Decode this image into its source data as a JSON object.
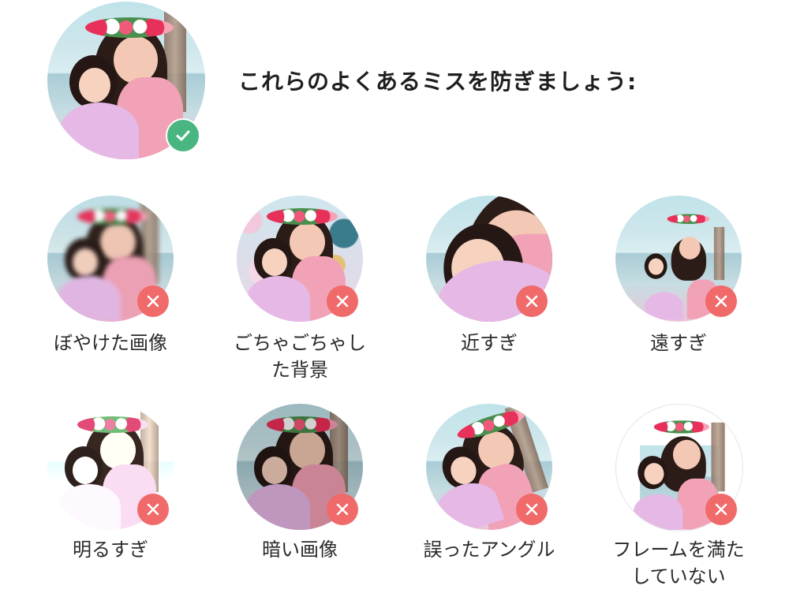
{
  "headline": "これらのよくあるミスを防ぎましょう:",
  "good_example": {
    "status": "correct",
    "badge_icon": "check-icon",
    "badge_color": "#49b581"
  },
  "mistakes": [
    {
      "key": "blurry",
      "label": "ぼやけた画像"
    },
    {
      "key": "cluttered",
      "label_line1": "ごちゃごちゃし",
      "label_line2": "た背景"
    },
    {
      "key": "too-close",
      "label": "近すぎ"
    },
    {
      "key": "too-far",
      "label": "遠すぎ"
    },
    {
      "key": "too-bright",
      "label": "明るすぎ"
    },
    {
      "key": "too-dark",
      "label": "暗い画像"
    },
    {
      "key": "wrong-angle",
      "label": "誤ったアングル"
    },
    {
      "key": "not-fill",
      "label_line1": "フレームを満た",
      "label_line2": "していない"
    }
  ],
  "badge_bad_icon": "close-icon",
  "badge_bad_color": "#f06a6a"
}
